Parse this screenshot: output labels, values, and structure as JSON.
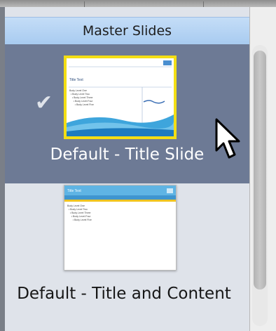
{
  "header": {
    "title": "Master Slides"
  },
  "slides": [
    {
      "label": "Default - Title Slide",
      "selected": true,
      "checkmark": "✔",
      "mini_title": "Title Text",
      "mini_body": "Body Level One\n  • Body Level Two\n    • Body Level Three\n      • Body Level Four\n        • Body Level Five"
    },
    {
      "label": "Default - Title and Content",
      "selected": false,
      "mini_title": "Title Text",
      "mini_body": "Body Level One\n  • Body Level Two\n    • Body Level Three\n      • Body Level Four\n        • Body Level Five"
    }
  ],
  "colors": {
    "panel_bg": "#dfe3ea",
    "selected_bg": "#6d7a95",
    "header_bg": "#b6d4f4",
    "selection_border": "#f3de14"
  },
  "icons": {
    "checkmark": "checkmark-icon",
    "cursor": "arrow-cursor-icon"
  }
}
